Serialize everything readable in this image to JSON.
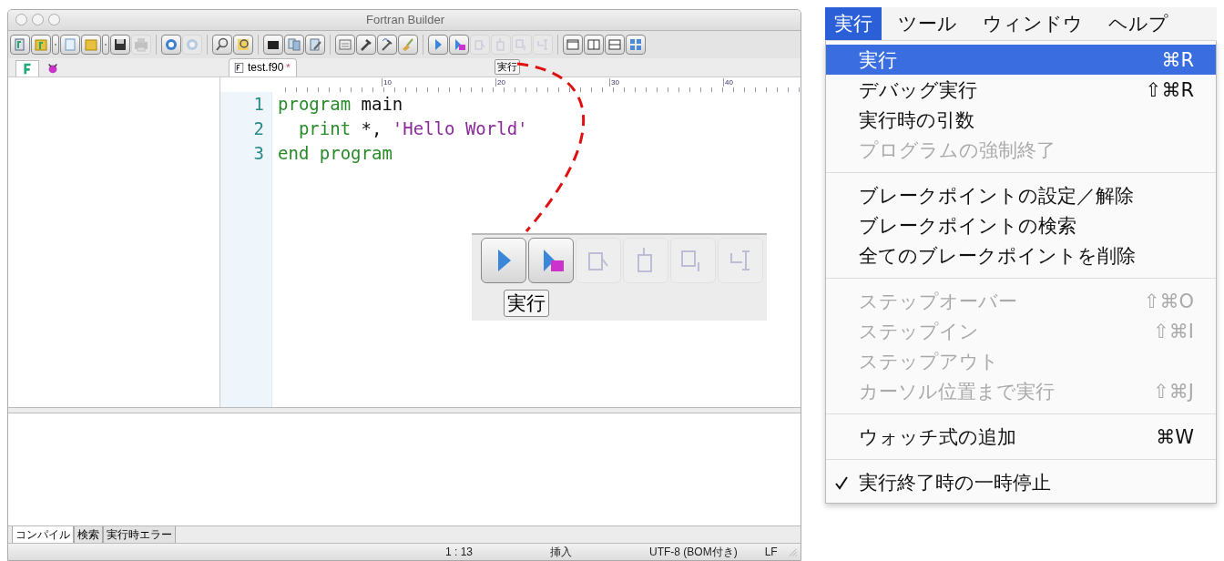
{
  "window": {
    "title": "Fortran Builder"
  },
  "toolbar": [
    {
      "kind": "button",
      "disabled": false
    },
    {
      "kind": "button",
      "disabled": false
    },
    {
      "kind": "dropdown"
    },
    {
      "kind": "button",
      "disabled": false
    },
    {
      "kind": "button",
      "disabled": false
    },
    {
      "kind": "dropdown"
    },
    {
      "kind": "button",
      "disabled": false
    },
    {
      "kind": "button",
      "disabled": true
    },
    {
      "kind": "separator"
    },
    {
      "kind": "button",
      "disabled": false
    },
    {
      "kind": "button",
      "disabled": true
    },
    {
      "kind": "separator"
    },
    {
      "kind": "button",
      "disabled": false
    },
    {
      "kind": "button",
      "disabled": false
    },
    {
      "kind": "separator"
    },
    {
      "kind": "button",
      "disabled": false
    },
    {
      "kind": "button",
      "disabled": false
    },
    {
      "kind": "button",
      "disabled": false
    },
    {
      "kind": "separator"
    },
    {
      "kind": "button",
      "disabled": false
    },
    {
      "kind": "button",
      "disabled": false
    },
    {
      "kind": "button",
      "disabled": false
    },
    {
      "kind": "button",
      "disabled": false
    },
    {
      "kind": "separator"
    },
    {
      "kind": "button",
      "disabled": false
    },
    {
      "kind": "button",
      "disabled": false
    },
    {
      "kind": "button",
      "disabled": true
    },
    {
      "kind": "button",
      "disabled": true
    },
    {
      "kind": "button",
      "disabled": true
    },
    {
      "kind": "button",
      "disabled": true
    },
    {
      "kind": "separator"
    },
    {
      "kind": "button",
      "disabled": false
    },
    {
      "kind": "button",
      "disabled": false
    },
    {
      "kind": "button",
      "disabled": false
    },
    {
      "kind": "button",
      "disabled": false
    }
  ],
  "side_tabs": [
    {
      "selected": true
    },
    {
      "selected": false
    }
  ],
  "editor": {
    "tab": {
      "label": "test.f90",
      "modified_mark": "*"
    },
    "tooltip": "実行",
    "ruler": [
      "10",
      "20",
      "30",
      "40"
    ],
    "lines": [
      {
        "number": "1",
        "tokens": [
          {
            "kind": "keyword",
            "text": "program"
          },
          {
            "kind": "plain",
            "text": " main"
          }
        ]
      },
      {
        "number": "2",
        "tokens": [
          {
            "kind": "keyword",
            "text": "  print"
          },
          {
            "kind": "plain",
            "text": " *, "
          },
          {
            "kind": "string",
            "text": "'Hello World'"
          }
        ]
      },
      {
        "number": "3",
        "tokens": [
          {
            "kind": "keyword",
            "text": "end program"
          }
        ]
      }
    ]
  },
  "inset": {
    "buttons": [
      {
        "disabled": false
      },
      {
        "disabled": false
      },
      {
        "disabled": true
      },
      {
        "disabled": true
      },
      {
        "disabled": true
      },
      {
        "disabled": true
      }
    ],
    "tooltip": "実行"
  },
  "bottom_tabs": [
    {
      "label": "コンパイル",
      "selected": true
    },
    {
      "label": "検索",
      "selected": false
    },
    {
      "label": "実行時エラー",
      "selected": false
    }
  ],
  "status_bar": {
    "position": "1 : 13",
    "mode": "挿入",
    "encoding": "UTF-8 (BOM付き)",
    "line_ending": "LF"
  },
  "menu_bar": [
    {
      "label": "実行",
      "selected": true
    },
    {
      "label": "ツール",
      "selected": false
    },
    {
      "label": "ウィンドウ",
      "selected": false
    },
    {
      "label": "ヘルプ",
      "selected": false
    }
  ],
  "menu": [
    {
      "kind": "item",
      "label": "実行",
      "shortcut": "⌘R",
      "selected": true,
      "disabled": false,
      "checked": false
    },
    {
      "kind": "item",
      "label": "デバッグ実行",
      "shortcut": "⇧⌘R",
      "selected": false,
      "disabled": false,
      "checked": false
    },
    {
      "kind": "item",
      "label": "実行時の引数",
      "selected": false,
      "disabled": false,
      "checked": false
    },
    {
      "kind": "item",
      "label": "プログラムの強制終了",
      "selected": false,
      "disabled": true,
      "checked": false
    },
    {
      "kind": "separator"
    },
    {
      "kind": "item",
      "label": "ブレークポイントの設定／解除",
      "selected": false,
      "disabled": false,
      "checked": false
    },
    {
      "kind": "item",
      "label": "ブレークポイントの検索",
      "selected": false,
      "disabled": false,
      "checked": false
    },
    {
      "kind": "item",
      "label": "全てのブレークポイントを削除",
      "selected": false,
      "disabled": false,
      "checked": false
    },
    {
      "kind": "separator"
    },
    {
      "kind": "item",
      "label": "ステップオーバー",
      "shortcut": "⇧⌘O",
      "selected": false,
      "disabled": true,
      "checked": false
    },
    {
      "kind": "item",
      "label": "ステップイン",
      "shortcut": "⇧⌘I",
      "selected": false,
      "disabled": true,
      "checked": false
    },
    {
      "kind": "item",
      "label": "ステップアウト",
      "selected": false,
      "disabled": true,
      "checked": false
    },
    {
      "kind": "item",
      "label": "カーソル位置まで実行",
      "shortcut": "⇧⌘J",
      "selected": false,
      "disabled": true,
      "checked": false
    },
    {
      "kind": "separator"
    },
    {
      "kind": "item",
      "label": "ウォッチ式の追加",
      "shortcut": "⌘W",
      "selected": false,
      "disabled": false,
      "checked": false
    },
    {
      "kind": "separator"
    },
    {
      "kind": "item",
      "label": "実行終了時の一時停止",
      "selected": false,
      "disabled": false,
      "checked": true
    }
  ]
}
